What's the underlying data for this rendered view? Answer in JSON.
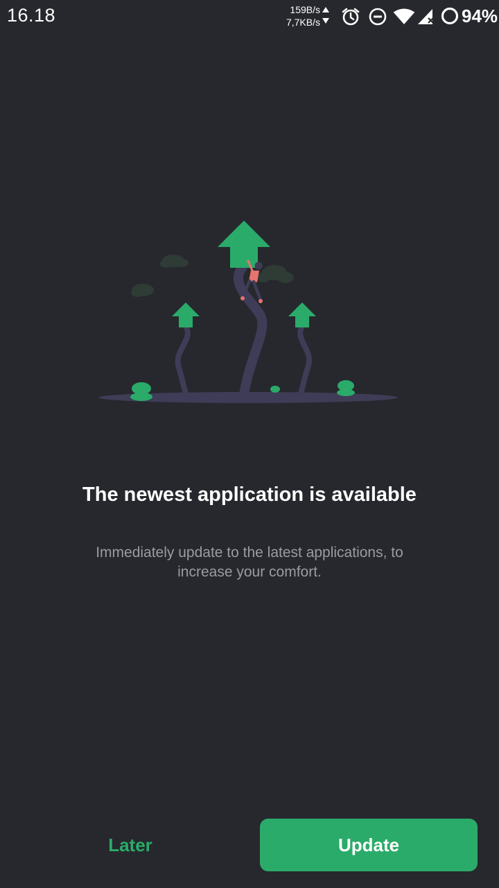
{
  "status_bar": {
    "time": "16.18",
    "net_up": "159B/s",
    "net_down": "7,7KB/s",
    "battery": "94%",
    "icons": [
      "alarm-icon",
      "do-not-disturb-icon",
      "wifi-icon",
      "cell-signal-icon",
      "battery-ring-icon"
    ]
  },
  "illustration": {
    "icon": "update-arrows-illustration",
    "accent_color": "#2bab6a"
  },
  "dialog": {
    "title": "The newest application is available",
    "subtitle": "Immediately update to the latest applications, to increase your comfort."
  },
  "actions": {
    "later_label": "Later",
    "update_label": "Update"
  },
  "colors": {
    "background": "#26282d",
    "accent": "#2bab6a",
    "title": "#ffffff",
    "subtitle": "#9a9ca1"
  }
}
